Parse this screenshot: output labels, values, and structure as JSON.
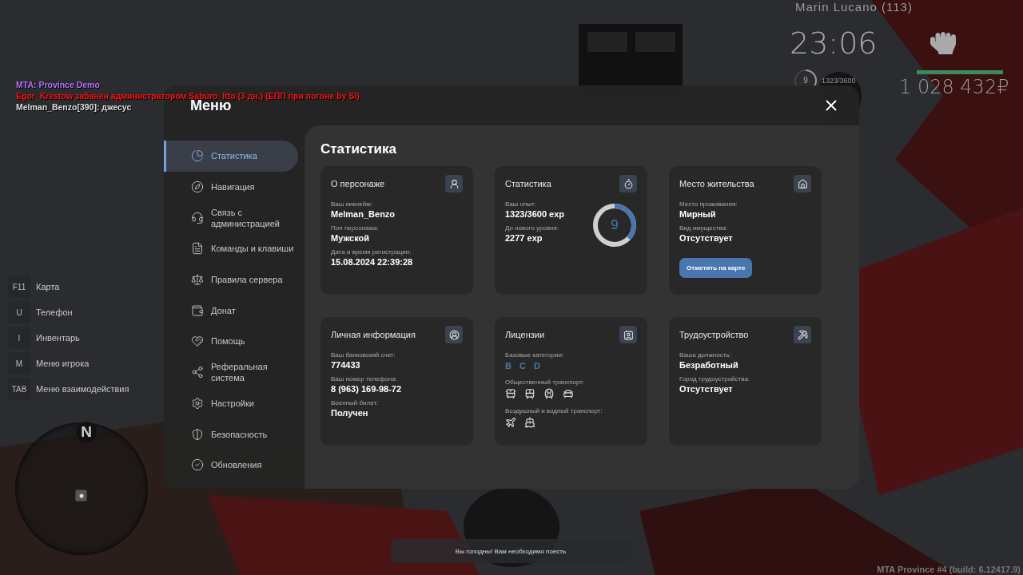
{
  "chat": [
    {
      "text": "MTA: Province Demo",
      "color": "#b070ff"
    },
    {
      "text": "Egor_Krestow забанен администратором Saburo_Itto (3 дн.) (ЕПП при погоне by SI)",
      "color": "#ff1010"
    },
    {
      "text": "Melman_Benzo[390]: джесус",
      "color": "#dddddd"
    }
  ],
  "hud": {
    "nametag": "Marin Lucano (113)",
    "clock": "23:06",
    "level": "9",
    "exp": "1323/3600",
    "exp_ring": {
      "level": 0.3675
    },
    "health": {
      "level": 1
    },
    "money": "1 028 432₽"
  },
  "hotkeys": [
    {
      "key": "F11",
      "label": "Карта"
    },
    {
      "key": "U",
      "label": "Телефон"
    },
    {
      "key": "I",
      "label": "Инвентарь"
    },
    {
      "key": "M",
      "label": "Меню игрока"
    },
    {
      "key": "TAB",
      "label": "Меню взаимодействия"
    }
  ],
  "minimap": {
    "north": "N"
  },
  "menu": {
    "title": "Меню",
    "sidebar": [
      {
        "label": "Статистика",
        "selected": true
      },
      {
        "label": "Навигация",
        "selected": false
      },
      {
        "label": "Связь с администрацией",
        "selected": false
      },
      {
        "label": "Команды и клавиши",
        "selected": false
      },
      {
        "label": "Правила сервера",
        "selected": false
      },
      {
        "label": "Донат",
        "selected": false
      },
      {
        "label": "Помощь",
        "selected": false
      },
      {
        "label": "Реферальная система",
        "selected": false
      },
      {
        "label": "Настройки",
        "selected": false
      },
      {
        "label": "Безопасность",
        "selected": false
      },
      {
        "label": "Обновления",
        "selected": false
      }
    ],
    "content": {
      "title": "Статистика",
      "cards": [
        {
          "kind": "fields",
          "title": "О персонаже",
          "fields": [
            {
              "label": "Ваш никнейм:",
              "value": "Melman_Benzo"
            },
            {
              "label": "Пол персонажа:",
              "value": "Мужской"
            },
            {
              "label": "Дата и время регистрации:",
              "value": "15.08.2024 22:39:28"
            }
          ]
        },
        {
          "kind": "stats",
          "title": "Статистика",
          "fields": [
            {
              "label": "Ваш опыт:",
              "value": "1323/3600 exp"
            },
            {
              "label": "До нового уровня:",
              "value": "2277 exp"
            }
          ],
          "ring_label": "9",
          "level": 0.3675
        },
        {
          "kind": "fields",
          "title": "Место жительства",
          "fields": [
            {
              "label": "Место проживания:",
              "value": "Мирный"
            },
            {
              "label": "Вид имущества:",
              "value": "Отсутствует"
            }
          ],
          "button": "Отметить на карте"
        },
        {
          "kind": "fields",
          "title": "Личная информация",
          "fields": [
            {
              "label": "Ваш банковский счет:",
              "value": "774433"
            },
            {
              "label": "Ваш номер телефона:",
              "value": "8 (963) 169-98-72"
            },
            {
              "label": "Военный билет:",
              "value": "Получен"
            }
          ]
        },
        {
          "kind": "licenses",
          "title": "Лицензии",
          "sections": [
            {
              "kind": "letters",
              "label": "Базовые категории:",
              "items": [
                "B",
                "C",
                "D"
              ]
            },
            {
              "kind": "icons",
              "label": "Общественный транспорт:"
            },
            {
              "kind": "icons",
              "label": "Воздушный и водный транспорт:"
            }
          ]
        },
        {
          "kind": "fields",
          "title": "Трудоустройство",
          "fields": [
            {
              "label": "Ваша должность:",
              "value": "Безработный"
            },
            {
              "label": "Город трудоустройства:",
              "value": "Отсутствует"
            }
          ]
        }
      ]
    }
  },
  "notification": "Вы голодны! Вам необходимо поесть",
  "build": "MTA Province #4 (build: 6.12417.9)"
}
